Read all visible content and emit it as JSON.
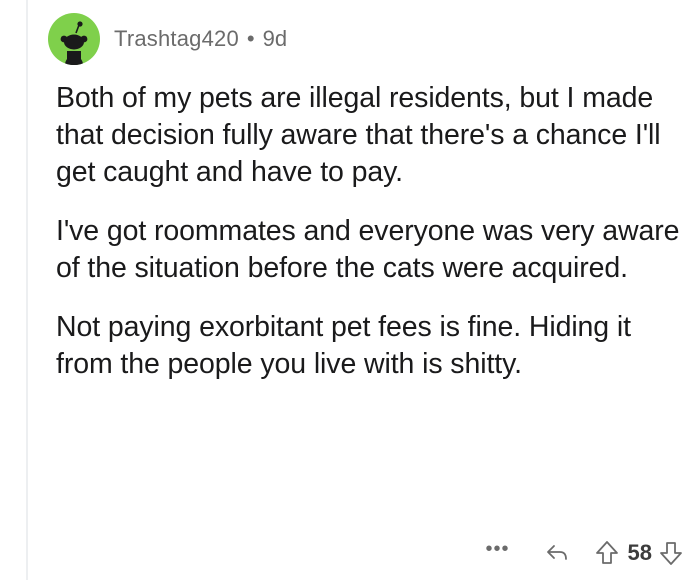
{
  "comment": {
    "username": "Trashtag420",
    "separator": "•",
    "age": "9d",
    "paragraphs": [
      "Both of my pets are illegal residents, but I made that decision fully aware that there's a chance I'll get caught and have to pay.",
      "I've got roommates and everyone was very aware of the situation before the cats were acquired.",
      "Not paying exorbitant pet fees is fine. Hiding it from the people you live with is shitty."
    ],
    "actions": {
      "more_label": "•••",
      "score": "58",
      "icons": [
        "more-options-icon",
        "reply-arrow-icon",
        "upvote-arrow-icon",
        "downvote-arrow-icon"
      ]
    },
    "colors": {
      "avatar_bg": "#7fd04b",
      "meta_text": "#6b6b6b",
      "body_text": "#1a1a1b"
    }
  }
}
